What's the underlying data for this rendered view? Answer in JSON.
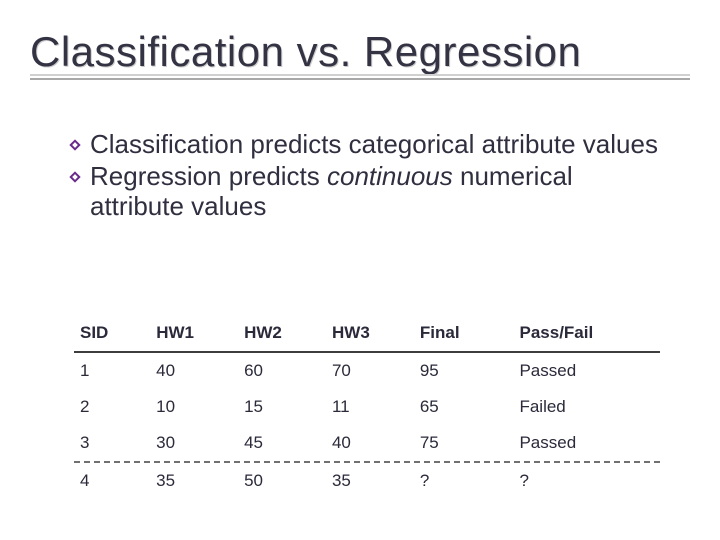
{
  "title": "Classification vs. Regression",
  "bullets": [
    {
      "pre": "Classification predicts categorical attribute values",
      "em": "",
      "post": ""
    },
    {
      "pre": "Regression predicts ",
      "em": "continuous",
      "post": " numerical attribute values"
    }
  ],
  "table": {
    "headers": [
      "SID",
      "HW1",
      "HW2",
      "HW3",
      "Final",
      "Pass/Fail"
    ],
    "rows": [
      [
        "1",
        "40",
        "60",
        "70",
        "95",
        "Passed"
      ],
      [
        "2",
        "10",
        "15",
        "11",
        "65",
        "Failed"
      ],
      [
        "3",
        "30",
        "45",
        "40",
        "75",
        "Passed"
      ],
      [
        "4",
        "35",
        "50",
        "35",
        "?",
        "?"
      ]
    ]
  }
}
